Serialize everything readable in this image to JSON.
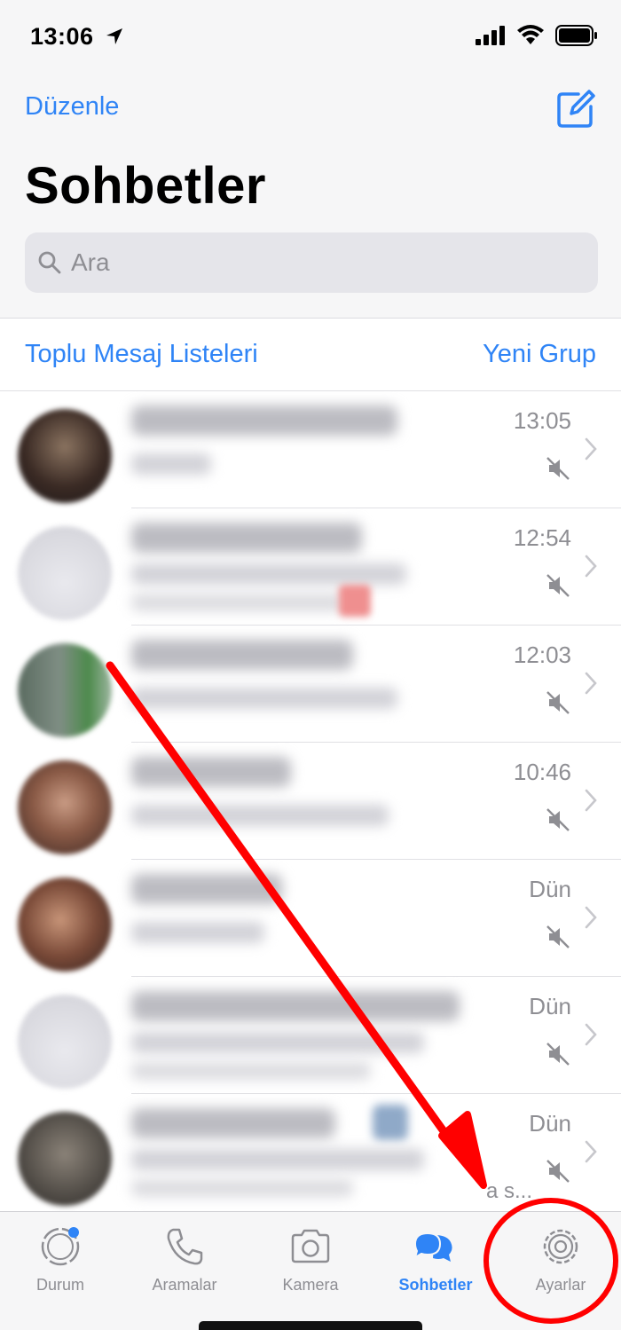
{
  "status_bar": {
    "time": "13:06"
  },
  "nav": {
    "edit_label": "Düzenle",
    "title": "Sohbetler"
  },
  "search": {
    "placeholder": "Ara"
  },
  "links": {
    "broadcast": "Toplu Mesaj Listeleri",
    "new_group": "Yeni Grup"
  },
  "chats": [
    {
      "time": "13:05"
    },
    {
      "time": "12:54"
    },
    {
      "time": "12:03"
    },
    {
      "time": "10:46"
    },
    {
      "time": "Dün"
    },
    {
      "time": "Dün"
    },
    {
      "time": "Dün",
      "preview_tail": "a s..."
    }
  ],
  "tabs": [
    {
      "label": "Durum",
      "icon": "status-icon"
    },
    {
      "label": "Aramalar",
      "icon": "phone-icon"
    },
    {
      "label": "Kamera",
      "icon": "camera-icon"
    },
    {
      "label": "Sohbetler",
      "icon": "chats-icon",
      "active": true
    },
    {
      "label": "Ayarlar",
      "icon": "gear-icon"
    }
  ],
  "colors": {
    "accent": "#2f84f6",
    "annotation": "#ff0000",
    "secondary_text": "#8e8e93"
  }
}
